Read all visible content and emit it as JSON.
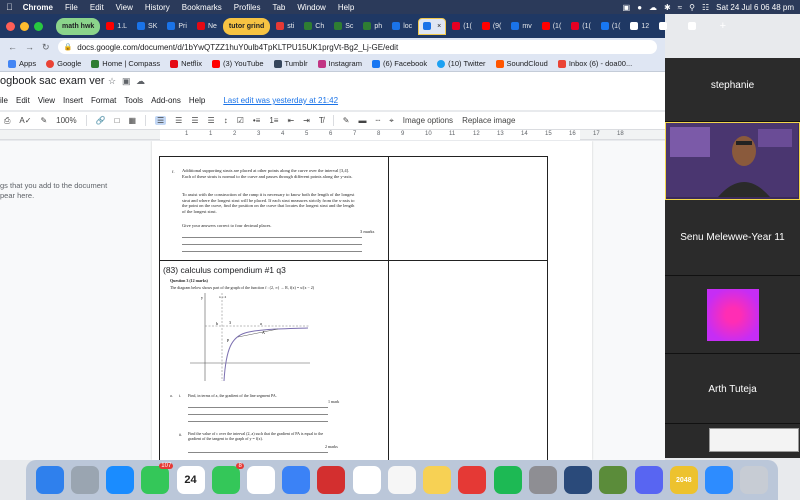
{
  "menubar": {
    "app": "Chrome",
    "items": [
      "File",
      "Edit",
      "View",
      "History",
      "Bookmarks",
      "Profiles",
      "Tab",
      "Window",
      "Help"
    ],
    "datetime": "Sat 24 Jul  6 06 48 pm"
  },
  "tabs": [
    {
      "label": "math hwk",
      "kind": "group",
      "color": "#8bd48b"
    },
    {
      "label": "1.L",
      "color": "#ff0000"
    },
    {
      "label": "SK",
      "color": "#1a73e8"
    },
    {
      "label": "Pri",
      "color": "#1a73e8"
    },
    {
      "label": "Ne",
      "color": "#e50914"
    },
    {
      "label": "tutor grind",
      "kind": "group",
      "color": "#f6c343"
    },
    {
      "label": "sti",
      "color": "#e53935"
    },
    {
      "label": "Ch",
      "color": "#2e7d32"
    },
    {
      "label": "Sc",
      "color": "#2e7d32"
    },
    {
      "label": "ph",
      "color": "#2e7d32"
    },
    {
      "label": "loc",
      "color": "#1a73e8"
    },
    {
      "label": "",
      "kind": "active",
      "color": "#1a73e8"
    },
    {
      "label": "(1(",
      "color": "#e60023"
    },
    {
      "label": "(9(",
      "color": "#ff0000"
    },
    {
      "label": "mv",
      "color": "#1a73e8"
    },
    {
      "label": "(1(",
      "color": "#ff0000"
    },
    {
      "label": "(1(",
      "color": "#e60023"
    },
    {
      "label": "(1(",
      "color": "#1877f2"
    },
    {
      "label": "12",
      "color": "#ffffff"
    },
    {
      "label": "pc",
      "color": "#ffffff"
    },
    {
      "label": "Ne",
      "color": "#ffffff"
    }
  ],
  "address": {
    "url": "docs.google.com/document/d/1bYwQTZZ1huY0ulb4TpKLTPU15UK1prgVt-Bg2_Lj-GE/edit"
  },
  "bookmarks": [
    "Apps",
    "Google",
    "Home | Compass",
    "Netflix",
    "(3) YouTube",
    "Tumblr",
    "Instagram",
    "(6) Facebook",
    "(10) Twitter",
    "SoundCloud",
    "Inbox (6) - doa00..."
  ],
  "doc": {
    "title": "ogbook sac exam ver",
    "menu": [
      "ile",
      "Edit",
      "View",
      "Insert",
      "Format",
      "Tools",
      "Add-ons",
      "Help"
    ],
    "last_edit": "Last edit was yesterday at 21:42"
  },
  "toolbar": {
    "zoom": "100%",
    "image_options": "Image options",
    "replace_image": "Replace image"
  },
  "ruler": {
    "marks": [
      "1",
      "1",
      "2",
      "3",
      "4",
      "5",
      "6",
      "7",
      "8",
      "9",
      "10",
      "11",
      "12",
      "13",
      "14",
      "15",
      "16",
      "17",
      "18"
    ]
  },
  "outline_note": "gs that you add to the document\npear here.",
  "question1": {
    "part": "f.",
    "text1": "Additional supporting struts are placed at other points along the curve over the interval [3,4]. Each of these struts is normal to the curve and passes through different points along the y-axis.",
    "text2": "To assist with the construction of the ramp it is necessary to know both the length of the longest strut and where the longest strut will be placed. If each strut measures strictly from the x-axis to the point on the curve, find the position on the curve that locates the longest strut and the length of the longest strut.",
    "text3": "Give your answers correct to four decimal places.",
    "marks": "3 marks"
  },
  "question2": {
    "heading": "(83) calculus compendium #1 q3",
    "sub": "Question 3 (12 marks)",
    "intro": "The diagram below shows part of the graph of the function  f : (2, ∞) → R,  f(x) = x/(x − 2)",
    "graph_labels": {
      "y_axis": "y",
      "asymptote": "x = 2",
      "b": "b",
      "three": "3",
      "a": "a",
      "A": "A",
      "P": "P"
    },
    "part_a": {
      "label": "a.",
      "sub": "i.",
      "text": "Find, in terms of a, the gradient of the line segment PA.",
      "marks": "1 mark"
    },
    "part_b": {
      "label": "ii.",
      "text": "Find the value of c over the interval (2, a) such that the gradient of PA is equal to the gradient of the tangent to the graph of y = f(x).",
      "marks": "2 marks"
    }
  },
  "participants": [
    {
      "name": "stephanie"
    },
    {
      "name": ""
    },
    {
      "name": "Senu Melewwe-Year 11"
    },
    {
      "name": ""
    },
    {
      "name": "Arth Tuteja"
    }
  ],
  "dock": [
    {
      "name": "finder",
      "color": "#2f80ed"
    },
    {
      "name": "launchpad",
      "color": "#9aa5b1"
    },
    {
      "name": "app-store",
      "color": "#1a8cff"
    },
    {
      "name": "messages",
      "color": "#34c759",
      "badge": "107"
    },
    {
      "name": "calendar",
      "color": "#ffffff",
      "text": "24"
    },
    {
      "name": "facetime",
      "color": "#34c759",
      "badge": "8"
    },
    {
      "name": "chrome",
      "color": "#ffffff"
    },
    {
      "name": "mail",
      "color": "#3b82f6"
    },
    {
      "name": "photo-booth",
      "color": "#d32f2f"
    },
    {
      "name": "photos",
      "color": "#ffffff"
    },
    {
      "name": "pages",
      "color": "#f6f6f6"
    },
    {
      "name": "notes",
      "color": "#f7d154"
    },
    {
      "name": "acrobat",
      "color": "#e53935"
    },
    {
      "name": "spotify",
      "color": "#1db954"
    },
    {
      "name": "settings",
      "color": "#8e8e93"
    },
    {
      "name": "vpn",
      "color": "#2a4a7a"
    },
    {
      "name": "minecraft",
      "color": "#5b8c3a"
    },
    {
      "name": "discord",
      "color": "#5865f2"
    },
    {
      "name": "game-2048",
      "color": "#edc22e",
      "text": "2048"
    },
    {
      "name": "zoom",
      "color": "#2d8cff"
    },
    {
      "name": "trash",
      "color": "#c7ccd4"
    }
  ]
}
